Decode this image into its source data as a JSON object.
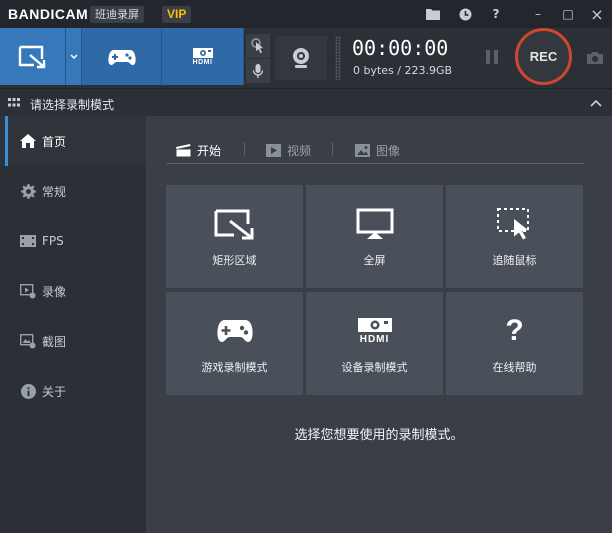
{
  "app": {
    "brand": "BANDICAM",
    "brand_cn": "班迪录屏",
    "vip": "VIP"
  },
  "title_icons": [
    "folder-icon",
    "clock-icon",
    "help-icon",
    "minimize-icon",
    "maximize-icon",
    "close-icon"
  ],
  "title_icon_glyphs": {
    "help": "?",
    "minimize": "–",
    "maximize": "□",
    "close": "×"
  },
  "toolbar": {
    "mode_buttons": [
      "rectangle-mode",
      "dropdown",
      "game-mode",
      "device-mode"
    ],
    "hdmi_text": "HDMI",
    "timer": "00:00:00",
    "storage": "0 bytes / 223.9GB",
    "rec_label": "REC"
  },
  "section": {
    "title": "请选择录制模式"
  },
  "sidebar": {
    "items": [
      {
        "label": "首页",
        "icon": "home-icon",
        "active": true
      },
      {
        "label": "常规",
        "icon": "gear-icon",
        "active": false
      },
      {
        "label": "FPS",
        "icon": "fps-icon",
        "active": false
      },
      {
        "label": "录像",
        "icon": "video-settings-icon",
        "active": false
      },
      {
        "label": "截图",
        "icon": "image-settings-icon",
        "active": false
      },
      {
        "label": "关于",
        "icon": "info-icon",
        "active": false
      }
    ]
  },
  "tabs": [
    {
      "label": "开始",
      "icon": "clapper-icon",
      "active": true
    },
    {
      "label": "视频",
      "icon": "play-icon",
      "active": false
    },
    {
      "label": "图像",
      "icon": "image-icon",
      "active": false
    }
  ],
  "tiles": [
    {
      "label": "矩形区域",
      "icon": "rectangle-area-icon"
    },
    {
      "label": "全屏",
      "icon": "monitor-icon"
    },
    {
      "label": "追随鼠标",
      "icon": "follow-mouse-icon"
    },
    {
      "label": "游戏录制模式",
      "icon": "gamepad-icon"
    },
    {
      "label": "设备录制模式",
      "icon": "hdmi-device-icon"
    },
    {
      "label": "在线帮助",
      "icon": "help-icon"
    }
  ],
  "tile_hdmi_text": "HDMI",
  "tile_help_glyph": "?",
  "hint": "选择您想要使用的录制模式。",
  "colors": {
    "accent_blue": "#2f6aa6",
    "rec_red": "#d1462f",
    "vip_yellow": "#f2c200"
  }
}
